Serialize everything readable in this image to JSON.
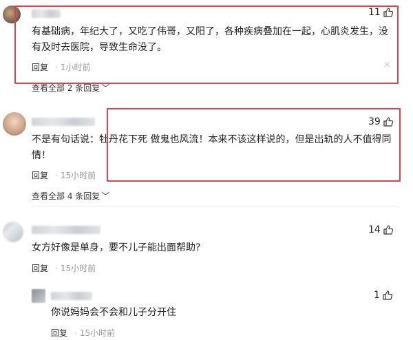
{
  "comments": [
    {
      "likes": "11",
      "text": "有基础病，年纪大了，又吃了伟哥，又阳了，各种疾病叠加在一起，心肌炎发生，没有及时去医院，导致生命没了。",
      "reply_label": "回复",
      "time": "1小时前",
      "view_all": "查看全部 2 条回复",
      "close": "×"
    },
    {
      "likes": "39",
      "text": "不是有句话说：牡丹花下死 做鬼也风流！本来不该这样说的，但是出轨的人不值得同情！",
      "reply_label": "回复",
      "time": "15小时前",
      "view_all": "查看全部 4 条回复"
    },
    {
      "likes": "14",
      "text": "女方好像是单身，要不儿子能出面帮助?",
      "reply_label": "回复",
      "time": "15小时前"
    }
  ],
  "sub_reply": {
    "likes": "1",
    "text": "你说妈妈会不会和儿子分开住",
    "reply_label": "回复",
    "time": "15小时前"
  },
  "colors": {
    "highlight": "#e0424d",
    "muted": "#999999"
  }
}
